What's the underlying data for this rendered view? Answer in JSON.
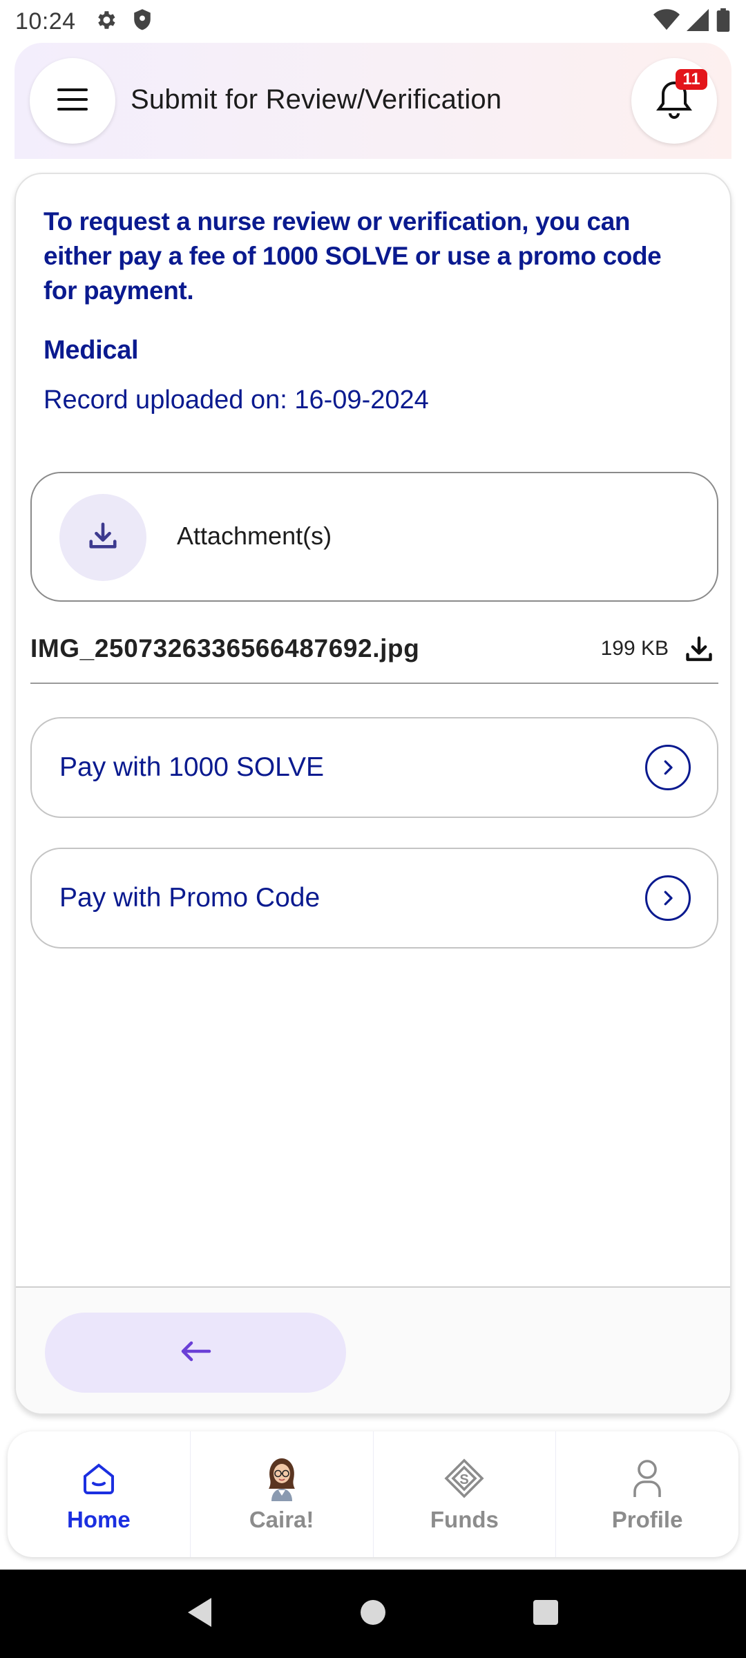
{
  "status_bar": {
    "time": "10:24",
    "left_icons": [
      "gear-icon",
      "shield-icon"
    ],
    "right_icons": [
      "wifi-icon",
      "signal-icon",
      "battery-icon"
    ]
  },
  "header": {
    "title": "Submit for Review/Verification",
    "notification_count": "11"
  },
  "card": {
    "intro": "To request a nurse review or verification, you can either pay a fee of 1000 SOLVE or use a promo code for payment.",
    "category": "Medical",
    "uploaded_on": "Record uploaded on: 16-09-2024",
    "attachment_label": "Attachment(s)",
    "file": {
      "name": "IMG_2507326336566487692.jpg",
      "size": "199 KB"
    },
    "pay_options": [
      {
        "label": "Pay with 1000 SOLVE"
      },
      {
        "label": "Pay with Promo Code"
      }
    ]
  },
  "bottom_nav": {
    "items": [
      {
        "label": "Home",
        "icon": "home-icon",
        "active": true
      },
      {
        "label": "Caira!",
        "icon": "caira-avatar-icon",
        "active": false
      },
      {
        "label": "Funds",
        "icon": "funds-icon",
        "active": false
      },
      {
        "label": "Profile",
        "icon": "profile-icon",
        "active": false
      }
    ]
  },
  "colors": {
    "primary_text": "#0a1a8f",
    "accent": "#1b2fe0",
    "badge": "#e3151a",
    "back_button_bg": "#ebe6fb",
    "back_arrow": "#6a3fd6"
  }
}
